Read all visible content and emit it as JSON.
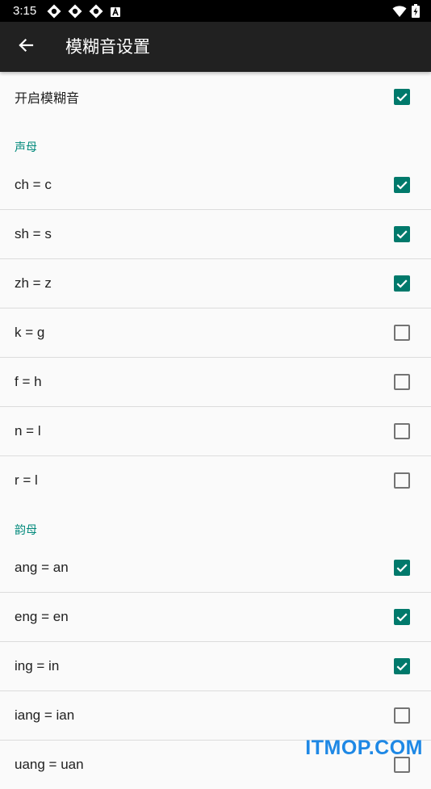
{
  "status_bar": {
    "time": "3:15",
    "left_icons": [
      "notification-icon",
      "notification-icon",
      "notification-icon",
      "keyboard-a-icon"
    ],
    "right_icons": [
      "wifi-icon",
      "battery-charging-icon"
    ]
  },
  "app_bar": {
    "back_icon": "arrow-back-icon",
    "title": "模糊音设置"
  },
  "master": {
    "label": "开启模糊音",
    "checked": true
  },
  "sections": [
    {
      "header": "声母",
      "items": [
        {
          "label": "ch = c",
          "checked": true
        },
        {
          "label": "sh = s",
          "checked": true
        },
        {
          "label": "zh = z",
          "checked": true
        },
        {
          "label": "k = g",
          "checked": false
        },
        {
          "label": "f = h",
          "checked": false
        },
        {
          "label": "n = l",
          "checked": false
        },
        {
          "label": "r = l",
          "checked": false
        }
      ]
    },
    {
      "header": "韵母",
      "items": [
        {
          "label": "ang = an",
          "checked": true
        },
        {
          "label": "eng = en",
          "checked": true
        },
        {
          "label": "ing = in",
          "checked": true
        },
        {
          "label": "iang = ian",
          "checked": false
        },
        {
          "label": "uang = uan",
          "checked": false
        }
      ]
    }
  ],
  "watermark": "ITMOP.COM",
  "colors": {
    "accent": "#00796b",
    "section_header": "#00897b",
    "app_bar": "#212121",
    "status_bar": "#000000",
    "background": "#fafafa",
    "divider": "#dcdcdc",
    "watermark": "#1e88e5"
  }
}
